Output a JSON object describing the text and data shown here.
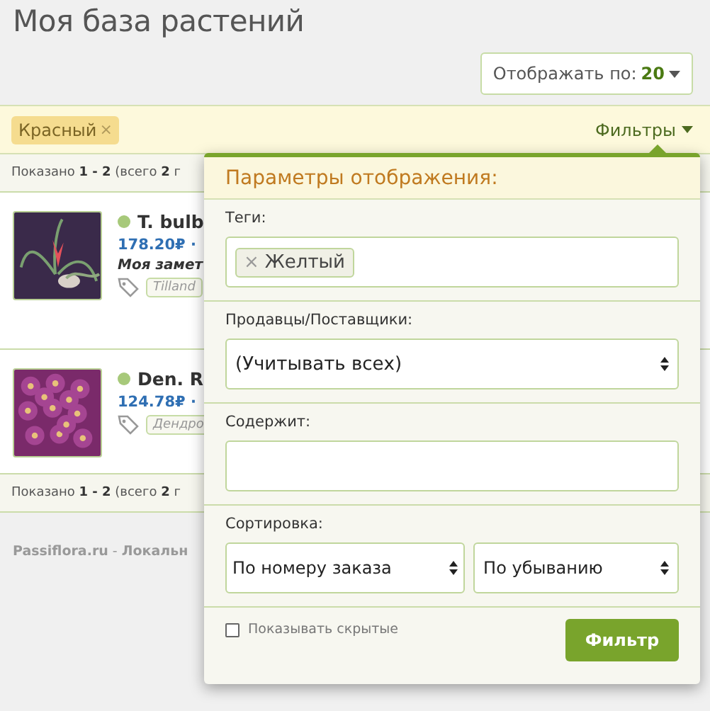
{
  "title": "Моя база растений",
  "per_page": {
    "label": "Отображать по:",
    "value": "20"
  },
  "active_tags": [
    {
      "label": "Красный",
      "remove": "×"
    }
  ],
  "filters_toggle": "Фильтры",
  "summary_top": "Показано **1 - 2** (всего **2** г",
  "items": [
    {
      "kind": "tillandsia",
      "name": "T. bulb",
      "price": "178.20₽ ·",
      "note": "Моя замет",
      "tags": [
        "Tilland"
      ]
    },
    {
      "kind": "orchid",
      "name": "Den. R",
      "price": "124.78₽ ·",
      "tags": [
        "Дендро"
      ]
    }
  ],
  "summary_bottom": "Показано **1 - 2** (всего **2** г",
  "footer": "**Passiflora.ru** - **Локальн**",
  "popup": {
    "title": "Параметры отображения:",
    "tags_label": "Теги:",
    "tags": [
      {
        "label": "Желтый",
        "remove": "×"
      }
    ],
    "sellers_label": "Продавцы/Поставщики:",
    "sellers_value": "(Учитывать всех)",
    "contains_label": "Содержит:",
    "sort_label": "Сортировка:",
    "sort_by": "По номеру заказа",
    "sort_order": "По убыванию",
    "show_hidden": {
      "label": "Показывать скрытые",
      "checked": false
    },
    "submit": "Фильтр"
  }
}
